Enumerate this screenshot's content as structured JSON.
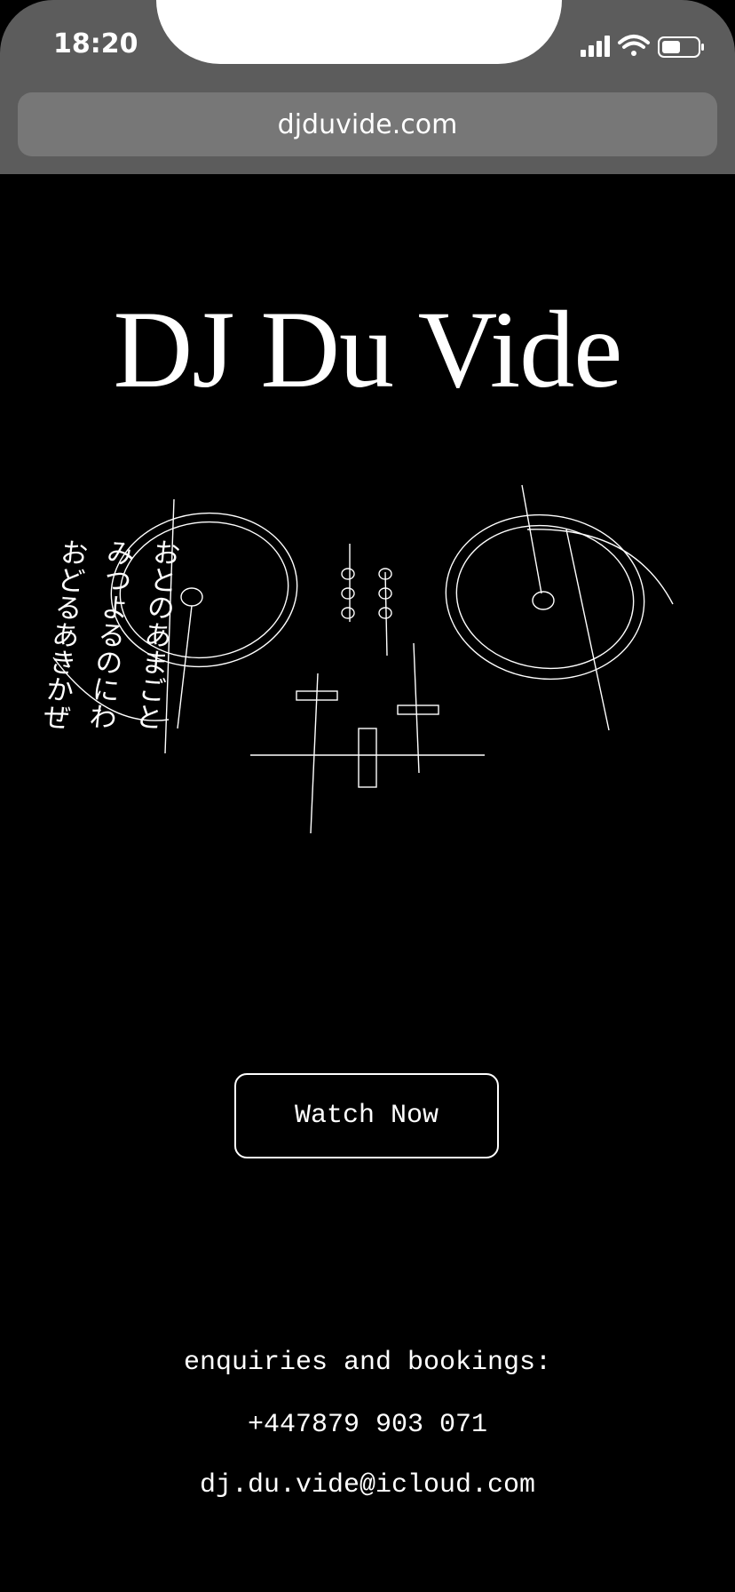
{
  "status_bar": {
    "time": "18:20",
    "icons": [
      "signal-icon",
      "wifi-icon",
      "battery-icon"
    ]
  },
  "browser": {
    "url": "djduvide.com"
  },
  "page": {
    "title": "DJ Du Vide",
    "poem_lines": [
      "おとのあまごと",
      "みつよるのにわ",
      "おどるあきかぜ"
    ],
    "watch_button_label": "Watch Now",
    "contact": {
      "label": "enquiries and bookings:",
      "phone": "+447879 903 071",
      "email": "dj.du.vide@icloud.com"
    }
  },
  "colors": {
    "background": "#000000",
    "status_bar": "#5c5c5c",
    "url_bar": "#777777",
    "foreground": "#ffffff"
  }
}
